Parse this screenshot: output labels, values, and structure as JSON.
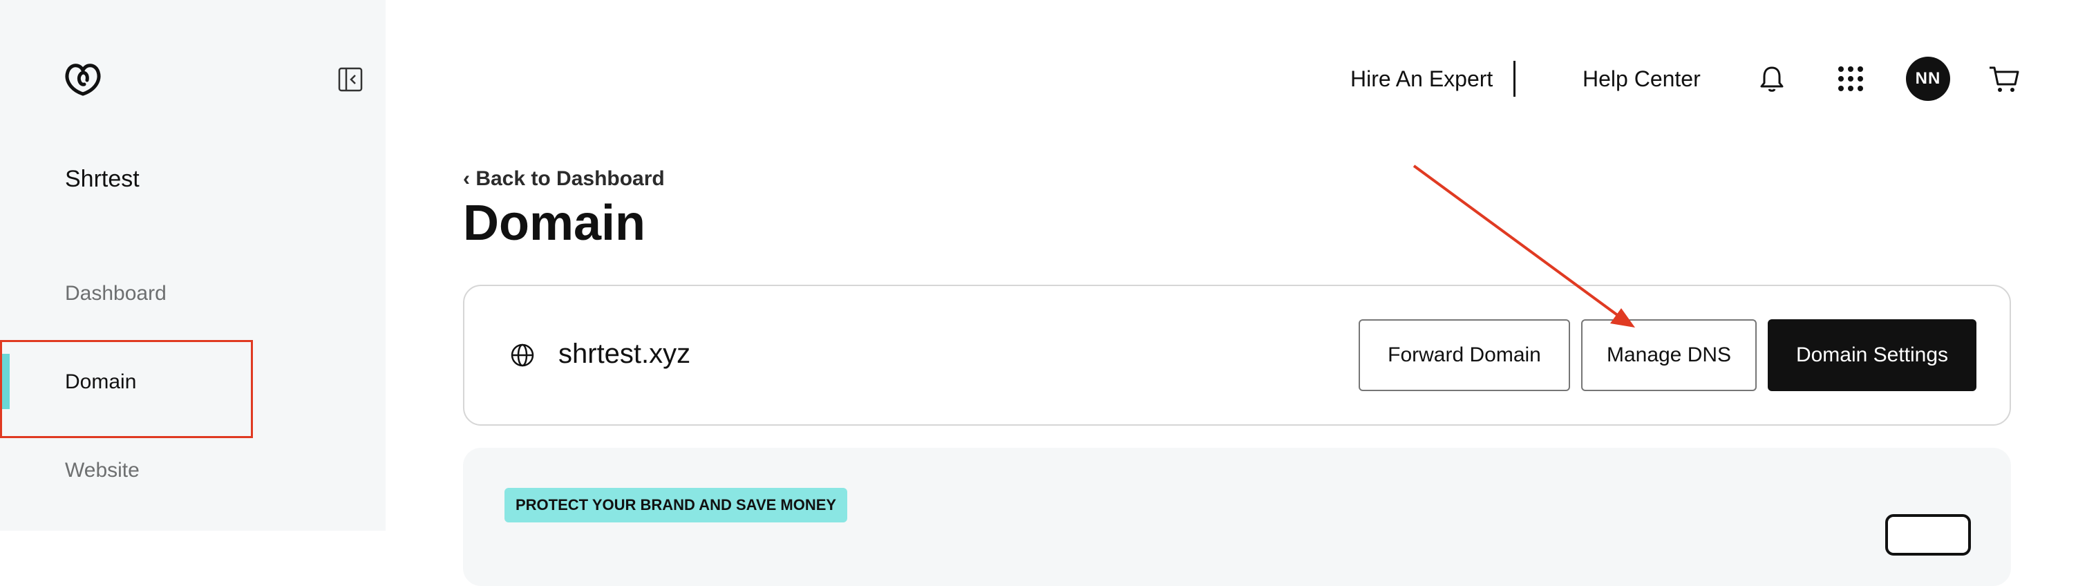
{
  "sidebar": {
    "site_name": "Shrtest",
    "items": [
      {
        "label": "Dashboard"
      },
      {
        "label": "Domain",
        "active": true
      },
      {
        "label": "Website"
      }
    ]
  },
  "header": {
    "links": [
      "Hire An Expert",
      "Help Center"
    ],
    "avatar_initials": "NN",
    "icons": [
      "bell-icon",
      "apps-grid-icon",
      "cart-icon"
    ]
  },
  "main": {
    "back_link": "‹ Back to Dashboard",
    "title": "Domain",
    "domain": {
      "name": "shrtest.xyz",
      "buttons": {
        "forward": "Forward Domain",
        "manage_dns": "Manage DNS",
        "settings": "Domain Settings"
      }
    },
    "promo": {
      "badge": "PROTECT YOUR BRAND AND SAVE MONEY"
    }
  },
  "colors": {
    "accent_teal": "#6ad7d6",
    "badge_teal": "#8ae6e3",
    "annotation_red": "#e03a22",
    "primary_dark": "#111111"
  }
}
